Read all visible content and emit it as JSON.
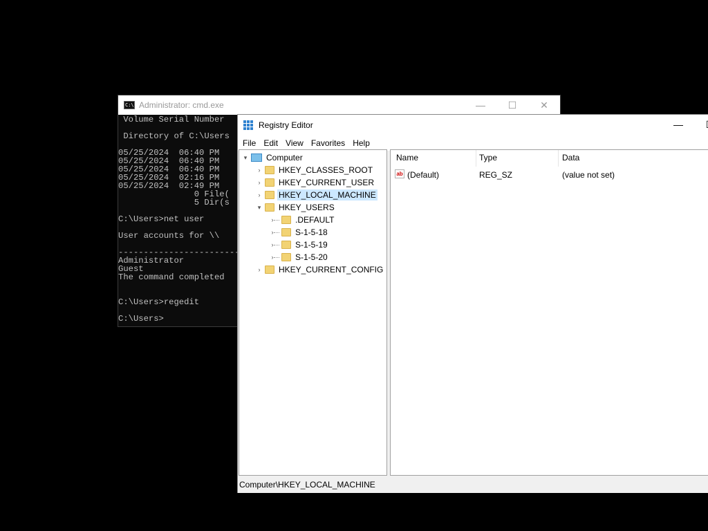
{
  "cmd": {
    "title": "Administrator: cmd.exe",
    "lines": [
      " Volume Serial Number",
      "",
      " Directory of C:\\Users",
      "",
      "05/25/2024  06:40 PM",
      "05/25/2024  06:40 PM",
      "05/25/2024  06:40 PM",
      "05/25/2024  02:16 PM",
      "05/25/2024  02:49 PM",
      "               0 File(",
      "               5 Dir(s",
      "",
      "C:\\Users>net user",
      "",
      "User accounts for \\\\",
      "",
      "-------------------------",
      "Administrator",
      "Guest",
      "The command completed",
      "",
      "",
      "C:\\Users>regedit",
      "",
      "C:\\Users>"
    ]
  },
  "regedit": {
    "title": "Registry Editor",
    "menu": [
      "File",
      "Edit",
      "View",
      "Favorites",
      "Help"
    ],
    "tree": {
      "root": "Computer",
      "hives": [
        "HKEY_CLASSES_ROOT",
        "HKEY_CURRENT_USER",
        "HKEY_LOCAL_MACHINE",
        "HKEY_USERS",
        "HKEY_CURRENT_CONFIG"
      ],
      "hkey_users_children": [
        ".DEFAULT",
        "S-1-5-18",
        "S-1-5-19",
        "S-1-5-20"
      ],
      "selected": "HKEY_LOCAL_MACHINE"
    },
    "list": {
      "columns": [
        "Name",
        "Type",
        "Data"
      ],
      "rows": [
        {
          "name": "(Default)",
          "type": "REG_SZ",
          "data": "(value not set)"
        }
      ]
    },
    "status": "Computer\\HKEY_LOCAL_MACHINE"
  }
}
